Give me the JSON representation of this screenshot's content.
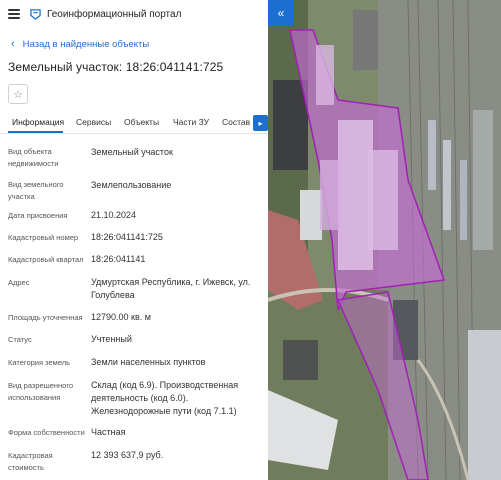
{
  "header": {
    "title": "Геоинформационный портал",
    "menu_icon": "hamburger-menu-icon",
    "logo_icon": "portal-logo-icon"
  },
  "nav": {
    "back_label": "Назад в найденные объекты"
  },
  "object": {
    "title": "Земельный участок: 18:26:041141:725"
  },
  "tabs": [
    {
      "label": "Информация",
      "active": true
    },
    {
      "label": "Сервисы"
    },
    {
      "label": "Объекты"
    },
    {
      "label": "Части ЗУ"
    },
    {
      "label": "Состав"
    }
  ],
  "attributes": [
    {
      "label": "Вид объекта недвижимости",
      "value": "Земельный участок"
    },
    {
      "label": "Вид земельного участка",
      "value": "Землепользование"
    },
    {
      "label": "Дата присвоения",
      "value": "21.10.2024"
    },
    {
      "label": "Кадастровый номер",
      "value": "18:26:041141:725"
    },
    {
      "label": "Кадастровый квартал",
      "value": "18:26:041141"
    },
    {
      "label": "Адрес",
      "value": "Удмуртская Республика, г. Ижевск, ул. Голублева"
    },
    {
      "label": "Площадь уточненная",
      "value": "12790.00 кв. м"
    },
    {
      "label": "Статус",
      "value": "Учтенный"
    },
    {
      "label": "Категория земель",
      "value": "Земли населенных пунктов"
    },
    {
      "label": "Вид разрешенного использования",
      "value": "Склад (код 6.9). Производственная деятельность (код 6.0). Железнодорожные пути (код 7.1.1)"
    },
    {
      "label": "Форма собственности",
      "value": "Частная"
    },
    {
      "label": "Кадастровая стоимость",
      "value": "12 393 637,9 руб."
    }
  ],
  "colors": {
    "accent": "#1c6fcf",
    "parcel_fill": "#c86ad8",
    "parcel_stroke": "#a21fb8"
  }
}
